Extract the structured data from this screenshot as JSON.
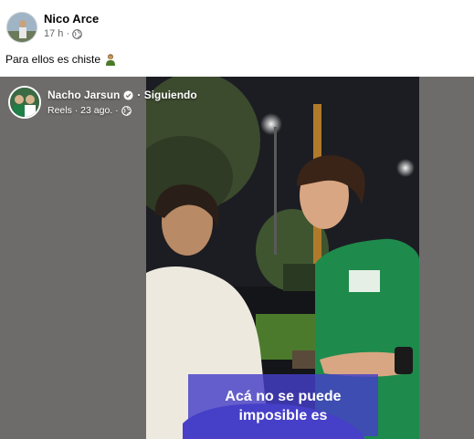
{
  "post": {
    "author": "Nico Arce",
    "time": "17 h ·",
    "caption": "Para ellos es chiste"
  },
  "reel": {
    "author": "Nacho Jarsun",
    "follow_status": "· Siguiendo",
    "meta": "Reels · 23 ago. ·",
    "subtitle_line1": "Acá no se puede",
    "subtitle_line2": "imposible es"
  },
  "icons": {
    "globe": "globe-icon",
    "verified": "verified-badge-icon",
    "emoji": "shrug-person-emoji-icon"
  },
  "colors": {
    "subtitle_bg": "#4640c8",
    "shirt_green": "#1e8a4c",
    "meta_gray": "#65676b"
  }
}
